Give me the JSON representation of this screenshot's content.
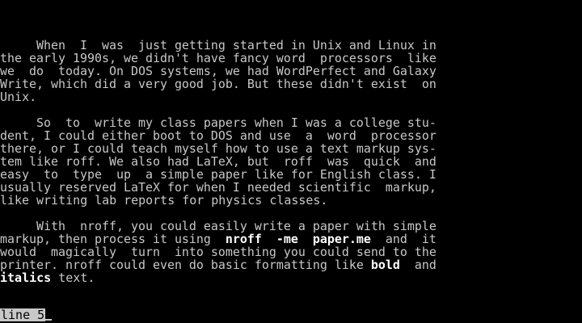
{
  "document": {
    "lines": [
      "     When  I  was  just getting started in Unix and Linux in",
      "the early 1990s, we didn't have fancy word  processors  like",
      "we  do  today. On DOS systems, we had WordPerfect and Galaxy",
      "Write, which did a very good job. But these didn't exist  on",
      "Unix.",
      "     So  to  write my class papers when I was a college stu-",
      "dent, I could either boot to DOS and use  a  word  processor",
      "there, or I could teach myself how to use a text markup sys-",
      "tem like roff. We also had LaTeX, but  roff  was  quick  and",
      "easy  to  type  up  a simple paper like for English class. I",
      "usually reserved LaTeX for when I needed scientific  markup,",
      "like writing lab reports for physics classes.",
      "     With  nroff, you could easily write a paper with simple"
    ],
    "line14_pre": "markup, then process it using  ",
    "line14_bold1": "nroff",
    "line14_mid": "  ",
    "line14_bold2": "-me",
    "line14_mid2": "  ",
    "line14_bold3": "paper.me",
    "line14_post": "  and  it",
    "line15": "would  magically  turn  into something you could send to the",
    "line16_pre": "printer. nroff could even do basic formatting like ",
    "line16_bold": "bold",
    "line16_post": "  and",
    "line17_bold": "italics",
    "line17_post": " text."
  },
  "status": {
    "prompt": "line 5"
  },
  "colors": {
    "background": "#000000",
    "text": "#c8c8c8",
    "bold_text": "#ffffff"
  }
}
